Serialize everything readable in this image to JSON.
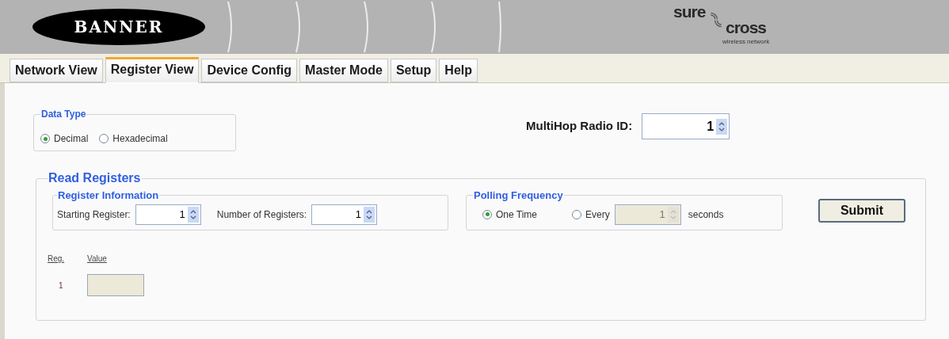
{
  "header": {
    "logo": "BANNER",
    "brand_top": "sure",
    "brand_bottom": "cross",
    "brand_tagline": "wireless network"
  },
  "tabs": [
    {
      "label": "Network View",
      "selected": false
    },
    {
      "label": "Register View",
      "selected": true
    },
    {
      "label": "Device Config",
      "selected": false
    },
    {
      "label": "Master Mode",
      "selected": false
    },
    {
      "label": "Setup",
      "selected": false
    },
    {
      "label": "Help",
      "selected": false
    }
  ],
  "data_type": {
    "legend": "Data Type",
    "options": [
      {
        "label": "Decimal",
        "selected": true
      },
      {
        "label": "Hexadecimal",
        "selected": false
      }
    ]
  },
  "radio_id": {
    "label": "MultiHop Radio ID:",
    "value": "1"
  },
  "read_registers": {
    "legend": "Read Registers",
    "register_information": {
      "legend": "Register Information",
      "fields": [
        {
          "label": "Starting Register:",
          "value": "1"
        },
        {
          "label": "Number of Registers:",
          "value": "1"
        }
      ]
    },
    "polling_frequency": {
      "legend": "Polling Frequency",
      "options": [
        {
          "label": "One Time",
          "selected": true
        },
        {
          "label": "Every",
          "selected": false
        }
      ],
      "interval": {
        "value": "1",
        "disabled": true
      },
      "unit": "seconds"
    },
    "submit": "Submit",
    "table": {
      "columns": [
        "Reg.",
        "Value"
      ],
      "rows": [
        {
          "reg": "1",
          "value_disabled": true
        }
      ]
    }
  }
}
